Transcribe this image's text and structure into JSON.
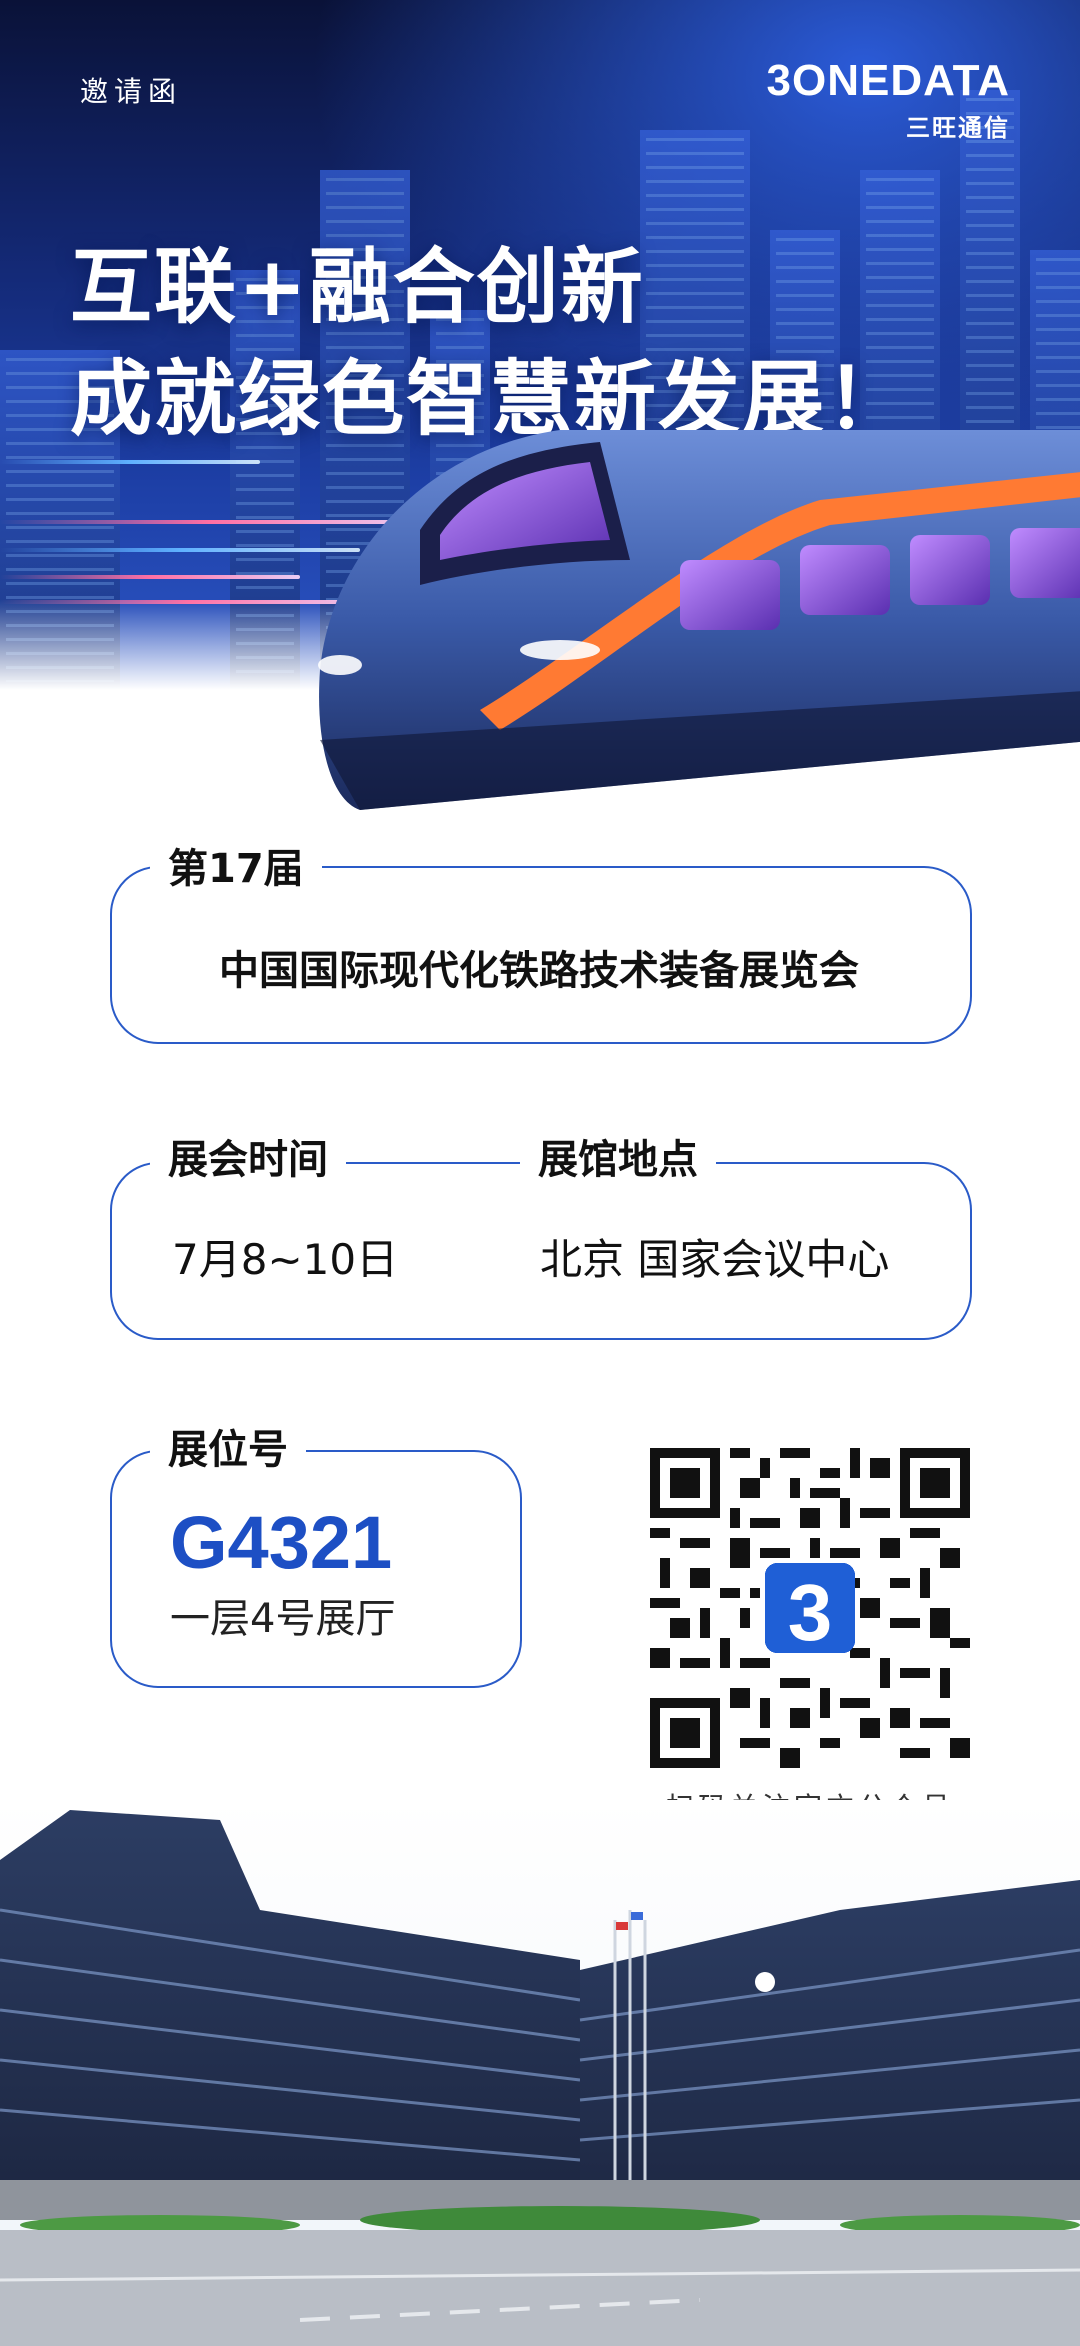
{
  "header": {
    "invite_label": "邀请函",
    "logo_text": "3ONEDATA",
    "logo_sub": "三旺通信"
  },
  "headline": {
    "line1": "互联+融合创新",
    "line2": "成就绿色智慧新发展！"
  },
  "event": {
    "edition": "第17届",
    "name": "中国国际现代化铁路技术装备展览会"
  },
  "schedule": {
    "time_label": "展会时间",
    "time_value": "7月8~10日",
    "venue_label": "展馆地点",
    "venue_value": "北京 国家会议中心"
  },
  "booth": {
    "label": "展位号",
    "number": "G4321",
    "hall": "一层4号展厅"
  },
  "qr": {
    "caption": "扫码关注官方公众号"
  },
  "colors": {
    "accent": "#2a5bc8",
    "booth_number": "#1d4fc4",
    "hero_dark": "#0a1238"
  }
}
